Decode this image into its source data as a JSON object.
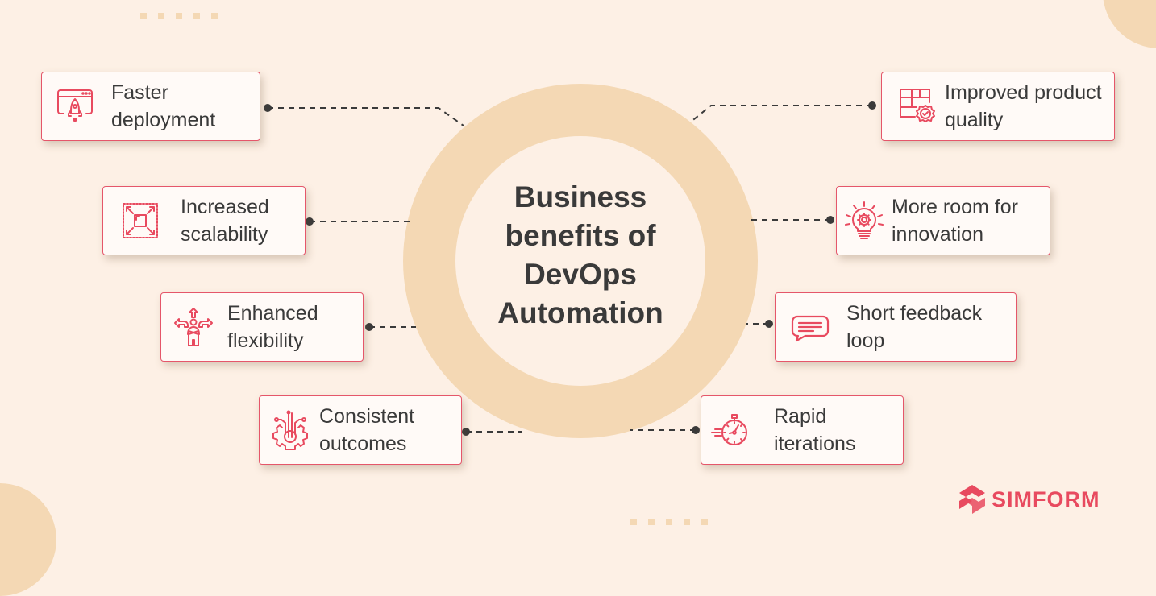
{
  "title": "Business benefits of DevOps Automation",
  "accent_color": "#e84a5f",
  "ring_color": "#f4d8b4",
  "background_color": "#fdf0e5",
  "benefits_left": [
    {
      "label": "Faster deployment",
      "icon": "rocket-window-icon"
    },
    {
      "label": "Increased scalability",
      "icon": "scale-expand-icon"
    },
    {
      "label": "Enhanced flexibility",
      "icon": "person-arrows-icon"
    },
    {
      "label": "Consistent outcomes",
      "icon": "gear-circuit-icon"
    }
  ],
  "benefits_right": [
    {
      "label": "Improved product quality",
      "icon": "quality-badge-icon"
    },
    {
      "label": "More room for innovation",
      "icon": "lightbulb-gear-icon"
    },
    {
      "label": "Short feedback loop",
      "icon": "chat-bubble-icon"
    },
    {
      "label": "Rapid iterations",
      "icon": "stopwatch-icon"
    }
  ],
  "brand": {
    "name": "SIMFORM"
  }
}
